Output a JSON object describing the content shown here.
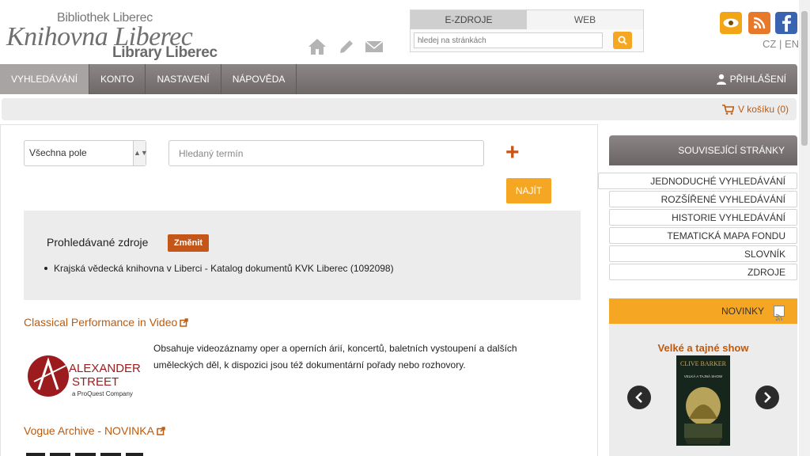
{
  "header": {
    "logo_small": "Bibliothek Liberec",
    "logo_main": "Knihovna Liberec",
    "logo_en": "Library Liberec",
    "icons": [
      "home-icon",
      "pencil-icon",
      "envelope-icon"
    ]
  },
  "site_search": {
    "tabs": [
      "E-ZDROJE",
      "WEB"
    ],
    "active_tab": "E-ZDROJE",
    "placeholder": "hledej na stránkách",
    "value": ""
  },
  "social": [
    "eye-icon",
    "rss-icon",
    "facebook-icon"
  ],
  "lang": {
    "cz": "CZ",
    "sep": " | ",
    "en": "EN"
  },
  "nav": {
    "items": [
      "VYHLEDÁVÁNÍ",
      "KONTO",
      "NASTAVENÍ",
      "NÁPOVĚDA"
    ],
    "active": "VYHLEDÁVÁNÍ",
    "login": "PŘIHLÁŠENÍ"
  },
  "cart": {
    "label": "V košíku (0)"
  },
  "search_form": {
    "field_select": "Všechna pole",
    "term_placeholder": "Hledaný termín",
    "term_value": "",
    "submit": "NAJÍT"
  },
  "sources": {
    "title": "Prohledávané zdroje",
    "change": "Změnit",
    "items": [
      "Krajská vědecká knihovna v Liberci - Katalog dokumentů KVK Liberec (1092098)"
    ]
  },
  "databases": [
    {
      "title": "Classical Performance in Video",
      "description": "Obsahuje videozáznamy oper a operních árií, koncertů, baletních vystoupení a dalších uměleckých děl, k dispozici jsou též dokumentární pořady nebo rozhovory.",
      "logo_text": [
        "ALEXANDER",
        "STREET",
        "a ProQuest Company"
      ]
    },
    {
      "title": "Vogue Archive - NOVINKA",
      "description": ""
    }
  ],
  "related": {
    "title": "SOUVISEJÍCÍ STRÁNKY",
    "items": [
      "JEDNODUCHÉ VYHLEDÁVÁNÍ",
      "ROZŠÍŘENÉ VYHLEDÁVÁNÍ",
      "HISTORIE VYHLEDÁVÁNÍ",
      "TEMATICKÁ MAPA FONDU",
      "SLOVNÍK",
      "ZDROJE"
    ]
  },
  "news": {
    "title": "NOVINKY",
    "book_title": "Velké a tajné show",
    "cover_author": "CLIVE BARKER",
    "cover_title": "VELKÁ A TAJNÁ SHOW"
  },
  "colors": {
    "accent": "#f5a623",
    "link": "#c05a0d",
    "brand_button": "#c4561a",
    "nav": "#7a7474"
  }
}
